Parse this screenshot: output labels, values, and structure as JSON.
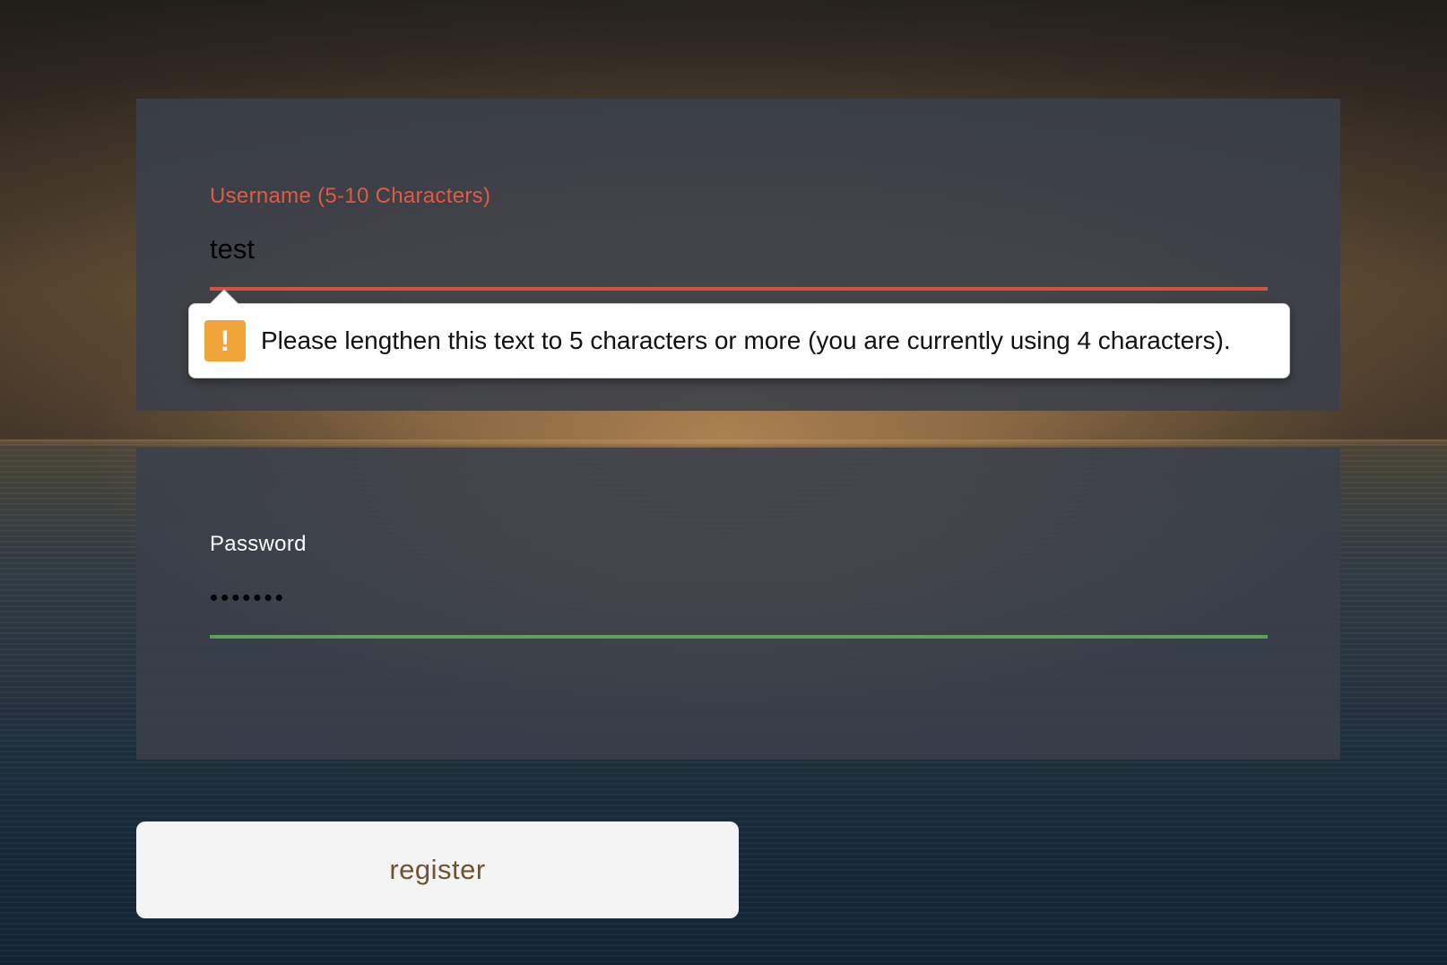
{
  "username_field": {
    "label": "Username (5-10 Characters)",
    "value": "test",
    "state_color": "#d4523f"
  },
  "validation_tooltip": {
    "icon": "warning-icon",
    "icon_glyph": "!",
    "message": "Please lengthen this text to 5 characters or more (you are currently using 4 characters)."
  },
  "password_field": {
    "label": "Password",
    "value": "•••••••",
    "state_color": "#5fa05a"
  },
  "register_button": {
    "label": "register"
  },
  "colors": {
    "error": "#e05a44",
    "valid": "#5fa05a",
    "warning": "#f0a43a",
    "button_text": "#6e5430"
  }
}
